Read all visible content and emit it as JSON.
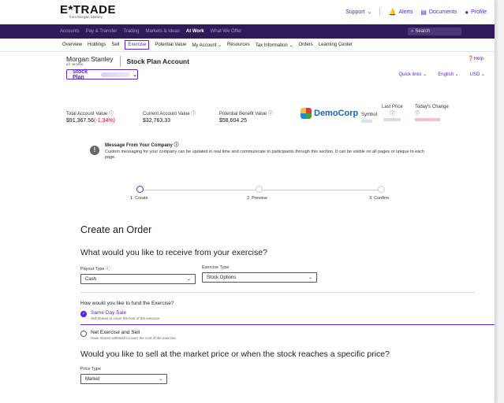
{
  "header": {
    "logo": "E*TRADE",
    "logo_sub": "from Morgan Stanley",
    "support": "Support",
    "alerts": "Alerts",
    "documents": "Documents",
    "profile": "Profile"
  },
  "nav": {
    "items": [
      "Accounts",
      "Pay & Transfer",
      "Trading",
      "Markets & Ideas",
      "At Work",
      "What We Offer"
    ],
    "active_index": 4,
    "search_placeholder": "Search"
  },
  "subnav": {
    "items": [
      "Overview",
      "Holdings",
      "Sell",
      "Exercise",
      "Potential Value",
      "My Account",
      "Resources",
      "Tax Information",
      "Orders",
      "Learning Center"
    ],
    "active_index": 3
  },
  "account": {
    "brand": "Morgan Stanley",
    "brand_sub": "AT WORK",
    "title": "Stock Plan Account",
    "help": "Help",
    "plan_label": "Stock Plan",
    "quick_links": "Quick links",
    "language": "English",
    "currency": "USD"
  },
  "summary": {
    "total_label": "Total Account Value",
    "total_value": "$91,367.56",
    "total_change": "(-1.34%)",
    "current_label": "Current Account Value",
    "current_value": "$32,763.33",
    "benefit_label": "Potential Benefit Value",
    "benefit_value": "$58,604.25",
    "company": "DemoCorp",
    "symbol_label": "Symbol",
    "last_price_label": "Last Price",
    "todays_change_label": "Today's Change"
  },
  "message": {
    "title": "Message From Your Company",
    "body": "Custom messaging for your company can be updated in real time and communicate to participants through this section. It can be visible on all pages or unique to each page."
  },
  "steps": [
    "1. Create",
    "2. Preview",
    "3. Confirm"
  ],
  "form": {
    "heading": "Create an Order",
    "receive_question": "What would you like to receive from your exercise?",
    "payout_label": "Payout Type",
    "payout_value": "Cash",
    "exercise_label": "Exercise Type",
    "exercise_value": "Stock Options",
    "fund_question": "How would you like to fund the Exercise?",
    "option1_title": "Same Day Sale",
    "option1_sub": "Sell shares to cover the cost of the exercise.",
    "option2_title": "Net Exercise and Sell",
    "option2_sub": "Have shares withheld to cover the cost of the exercise.",
    "price_question": "Would you like to sell at the market price or when the stock reaches a specific price?",
    "price_label": "Price Type",
    "price_value": "Market"
  },
  "colors": {
    "accent": "#5627d8",
    "nav_bg": "#2f1b59",
    "negative": "#d0021b"
  }
}
